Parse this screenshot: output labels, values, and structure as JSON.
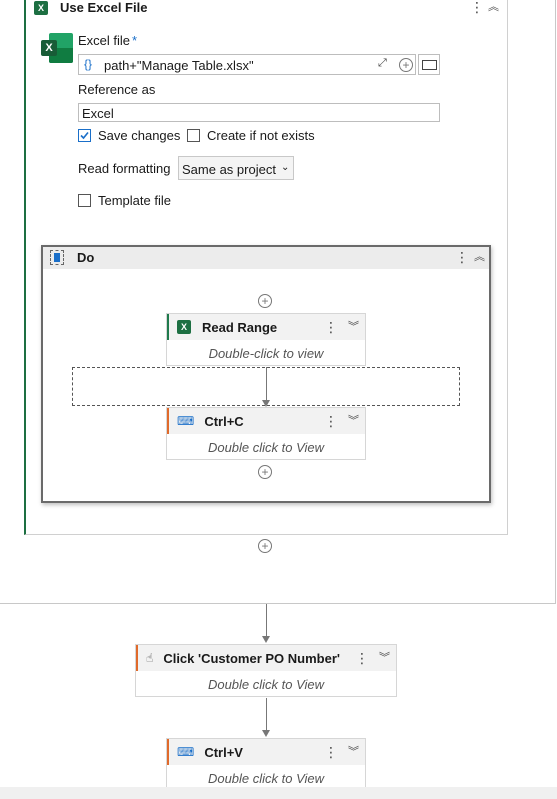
{
  "use_excel": {
    "title": "Use Excel File",
    "excel_file_label": "Excel file",
    "required_mark": "*",
    "excel_file_value": "path+\"Manage Table.xlsx\"",
    "reference_label": "Reference as",
    "reference_value": "Excel",
    "save_changes_label": "Save changes",
    "save_changes_checked": true,
    "create_label": "Create if not exists",
    "create_checked": false,
    "read_formatting_label": "Read formatting",
    "read_formatting_value": "Same as project",
    "template_label": "Template file",
    "template_checked": false
  },
  "do_block": {
    "title": "Do",
    "read_range": {
      "title": "Read Range",
      "body": "Double-click to view",
      "accent": "#1f7a4c"
    },
    "ctrl_c": {
      "title": "Ctrl+C",
      "body": "Double click to View",
      "accent": "#e06a2b"
    }
  },
  "click_activity": {
    "title": "Click 'Customer PO Number'",
    "body": "Double click to View",
    "accent": "#e06a2b"
  },
  "ctrl_v": {
    "title": "Ctrl+V",
    "body": "Double click to View",
    "accent": "#e06a2b"
  },
  "colors": {
    "excel_green": "#1d6f42",
    "accent_orange": "#e06a2b",
    "checkbox_blue": "#1a6fc9"
  }
}
